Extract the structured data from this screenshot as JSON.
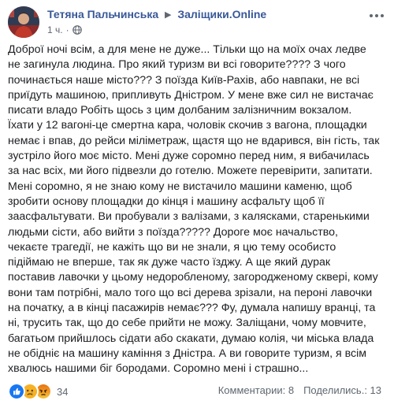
{
  "post": {
    "author": "Тетяна Пальчинська",
    "group": "Заліщики.Online",
    "time": "1 ч.",
    "privacy_icon": "globe-icon",
    "text": "Доброї ночі всім, а для мене не дуже... Тільки що на моїх очах ледве не загинула людина. Про який туризм ви всі говорите???? З чого починається наше місто??? З поїзда Київ-Рахів, або навпаки, не всі приїдуть машиною, припливуть Дністром. У мене вже сил не вистачає писати владо Робіть щось з цим долбаним залізничним вокзалом. Їхати у 12 вагоні-це смертна кара, чоловік скочив з вагона, площадки немає і впав, до рейси міліметраж, щастя що не вдарився, він гість, так зустріло його моє місто. Мені дуже соромно перед ним, я вибачилась за нас всіх, ми його підвезли до готелю. Можете перевірити, запитати. Мені соромно, я не знаю кому не вистачило машини каменю, щоб зробити основу площадки до кінця і машину асфальту щоб її заасфальтувати. Ви пробували з валізами, з калясками, старенькими людьми сісти, або вийти з поїзда????? Дороге моє начальство, чекаєте трагедії, не кажіть що ви не знали, я цю тему особисто підіймаю не вперше, так як дуже часто їзджу. А ще який дурак поставив лавочки у цьому недоробленому, загородженому сквері, кому вони там потрібні, мало того що всі дерева зрізали, на пероні лавочки на початку, а в кінці пасажирів немає??? Фу, думала напишу вранці, та ні, трусить так, що до себе прийти не можу. Заліщани, чому мовчите, багатьом прийшлось сідати або скакати, думаю колія, чи міська влада не обідніє на машину каміння з Дністра. А ви говорите туризм, я всім хвалюсь нашими біг бородами. Соромно мені і страшно..."
  },
  "reactions": {
    "icons": [
      "like-icon",
      "sad-icon",
      "angry-icon"
    ],
    "colors": {
      "like": "#1877f2",
      "sad": "#f7b125",
      "angry": "#e9710f"
    },
    "count": "34"
  },
  "stats": {
    "comments": "Комментарии: 8",
    "shares": "Поделились.: 13"
  },
  "colors": {
    "link": "#385898",
    "secondary": "#606770",
    "text": "#1c1e21"
  }
}
